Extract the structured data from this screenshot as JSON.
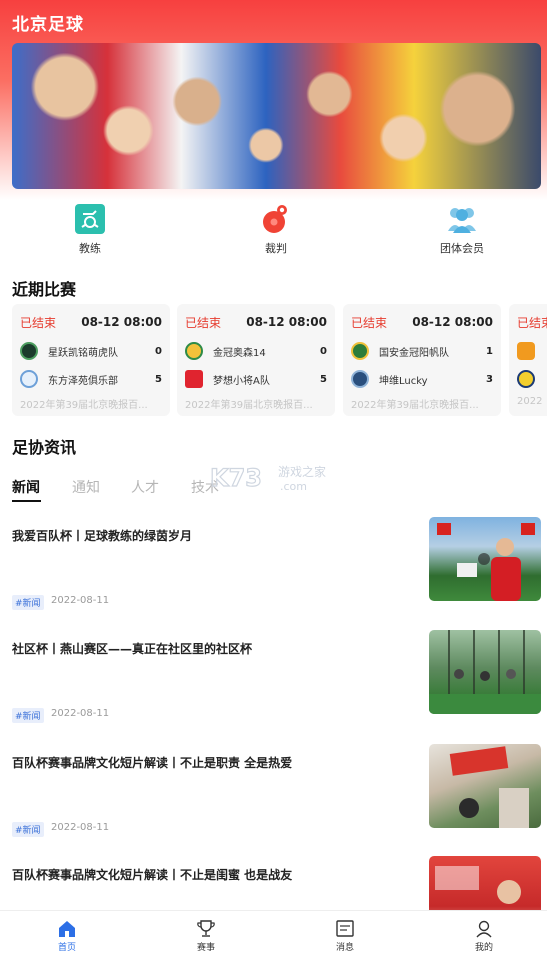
{
  "app": {
    "title": "北京足球"
  },
  "quick_nav": [
    {
      "label": "教练",
      "icon": "coach-whistle-icon"
    },
    {
      "label": "裁判",
      "icon": "referee-whistle-icon"
    },
    {
      "label": "团体会员",
      "icon": "group-members-icon"
    }
  ],
  "recent_matches": {
    "title": "近期比赛",
    "cards": [
      {
        "status": "已结束",
        "time": "08-12 08:00",
        "home": {
          "name": "星跃凯铭萌虎队",
          "score": "0"
        },
        "away": {
          "name": "东方泽苑俱乐部",
          "score": "5"
        },
        "league": "2022年第39届北京晚报百..."
      },
      {
        "status": "已结束",
        "time": "08-12 08:00",
        "home": {
          "name": "金冠奥森14",
          "score": "0"
        },
        "away": {
          "name": "梦想小将A队",
          "score": "5"
        },
        "league": "2022年第39届北京晚报百..."
      },
      {
        "status": "已结束",
        "time": "08-12 08:00",
        "home": {
          "name": "国安金冠阳帆队",
          "score": "1"
        },
        "away": {
          "name": "坤维Lucky",
          "score": "3"
        },
        "league": "2022年第39届北京晚报百..."
      },
      {
        "status": "已结束",
        "time": "",
        "home": {
          "name": "",
          "score": ""
        },
        "away": {
          "name": "",
          "score": ""
        },
        "league": "2022"
      }
    ]
  },
  "news_section": {
    "title": "足协资讯",
    "tabs": [
      "新闻",
      "通知",
      "人才",
      "技术"
    ],
    "watermark": "K73 游戏之家 .com",
    "items": [
      {
        "title": "我爱百队杯丨足球教练的绿茵岁月",
        "tag": "#新闻",
        "date": "2022-08-11"
      },
      {
        "title": "社区杯丨燕山赛区——真正在社区里的社区杯",
        "tag": "#新闻",
        "date": "2022-08-11"
      },
      {
        "title": "百队杯赛事品牌文化短片解读丨不止是职责 全是热爱",
        "tag": "#新闻",
        "date": "2022-08-11"
      },
      {
        "title": "百队杯赛事品牌文化短片解读丨不止是闺蜜 也是战友",
        "tag": "#新闻",
        "date": ""
      }
    ]
  },
  "bottom_nav": [
    {
      "label": "首页",
      "icon": "home-icon",
      "active": true
    },
    {
      "label": "赛事",
      "icon": "trophy-icon",
      "active": false
    },
    {
      "label": "消息",
      "icon": "message-icon",
      "active": false
    },
    {
      "label": "我的",
      "icon": "profile-icon",
      "active": false
    }
  ],
  "colors": {
    "accent_red": "#f7403f",
    "status_red": "#e63b2e",
    "active_blue": "#2c6fe6",
    "tag_blue": "#3a70d8"
  }
}
